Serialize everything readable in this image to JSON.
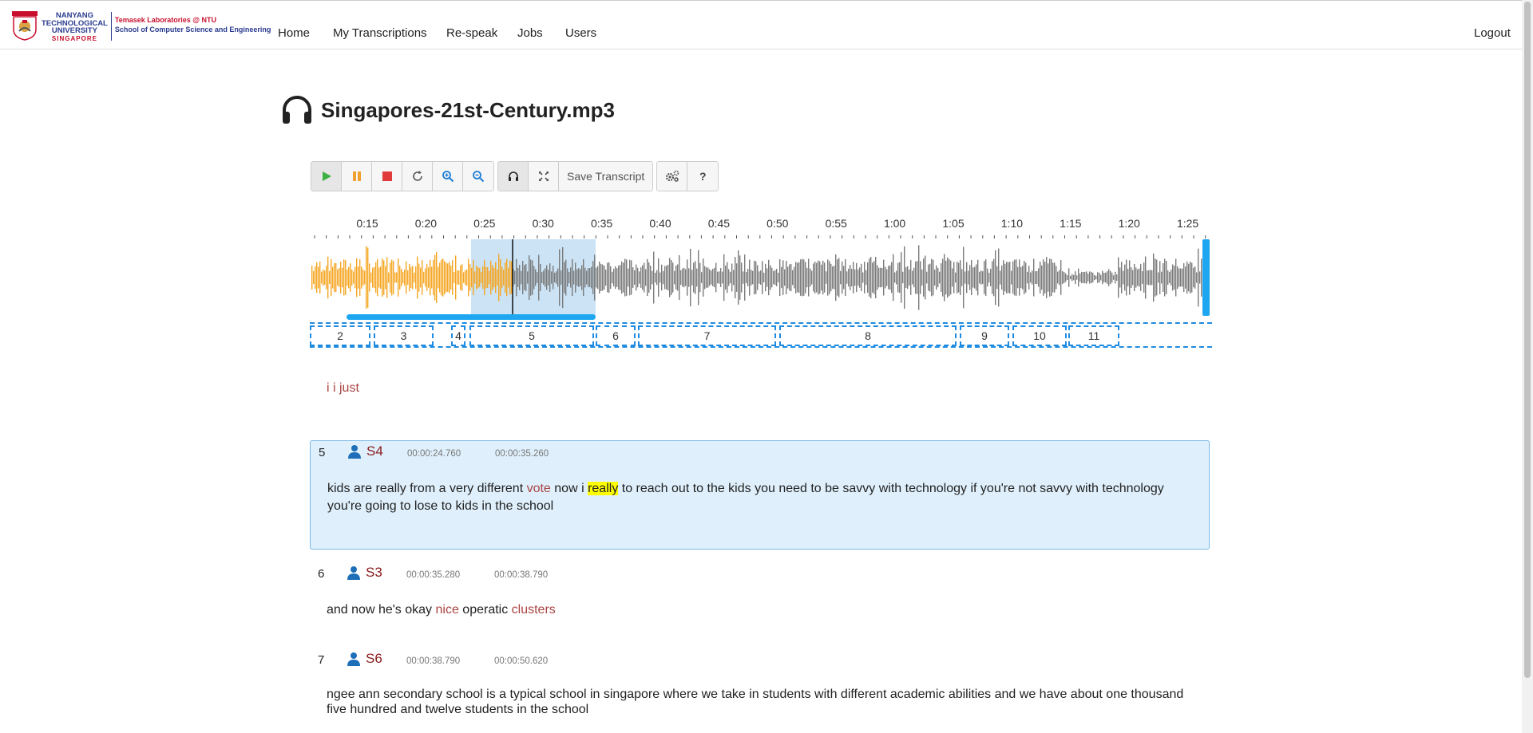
{
  "header": {
    "logo": {
      "univ_line1": "NANYANG",
      "univ_line2": "TECHNOLOGICAL",
      "univ_line3": "UNIVERSITY",
      "univ_line4": "SINGAPORE",
      "lab_line1": "Temasek Laboratories @ NTU",
      "lab_line2": "School of Computer Science and Engineering"
    },
    "nav": [
      "Home",
      "My Transcriptions",
      "Re-speak",
      "Jobs",
      "Users"
    ],
    "logout": "Logout"
  },
  "file": {
    "name": "Singapores-21st-Century.mp3",
    "icon": "headphones-icon"
  },
  "toolbar": {
    "buttons": [
      "play-icon",
      "pause-icon",
      "stop-icon",
      "replay-icon",
      "zoom-in-icon",
      "zoom-out-icon",
      "headphones-icon",
      "fullscreen-icon"
    ],
    "save_label": "Save Transcript",
    "settings_icon": "settings-icon",
    "help_label": "?"
  },
  "timeline": {
    "labels": [
      "0:15",
      "0:20",
      "0:25",
      "0:30",
      "0:35",
      "0:40",
      "0:45",
      "0:50",
      "0:55",
      "1:00",
      "1:05",
      "1:10",
      "1:15",
      "1:20",
      "1:25"
    ],
    "played_color": "#f5a623",
    "unplayed_color": "#7a7a7a",
    "selection_color": "#b9d9f2",
    "accent": "#1ea7f0"
  },
  "regions": [
    "2",
    "3",
    "4",
    "5",
    "6",
    "7",
    "8",
    "9",
    "10",
    "11"
  ],
  "snippet": "i i just",
  "segments": [
    {
      "num": "5",
      "speaker": "S4",
      "start": "00:00:24.760",
      "end": "00:00:35.260",
      "t1": "kids are really from a very different ",
      "t2": "vote",
      "t3": " now i ",
      "t4": "really",
      "t5": " to reach out to the kids you need to be savvy with technology if you're not savvy with technology you're going to lose to kids in the school"
    },
    {
      "num": "6",
      "speaker": "S3",
      "start": "00:00:35.280",
      "end": "00:00:38.790",
      "t1": "and now he's okay ",
      "t2": "nice",
      "t3": " operatic ",
      "t4": "clusters"
    },
    {
      "num": "7",
      "speaker": "S6",
      "start": "00:00:38.790",
      "end": "00:00:50.620",
      "t1": "ngee ann secondary school is a typical school in singapore where we take in students with different academic abilities and we have about one thousand five hundred and twelve students in the school"
    }
  ]
}
